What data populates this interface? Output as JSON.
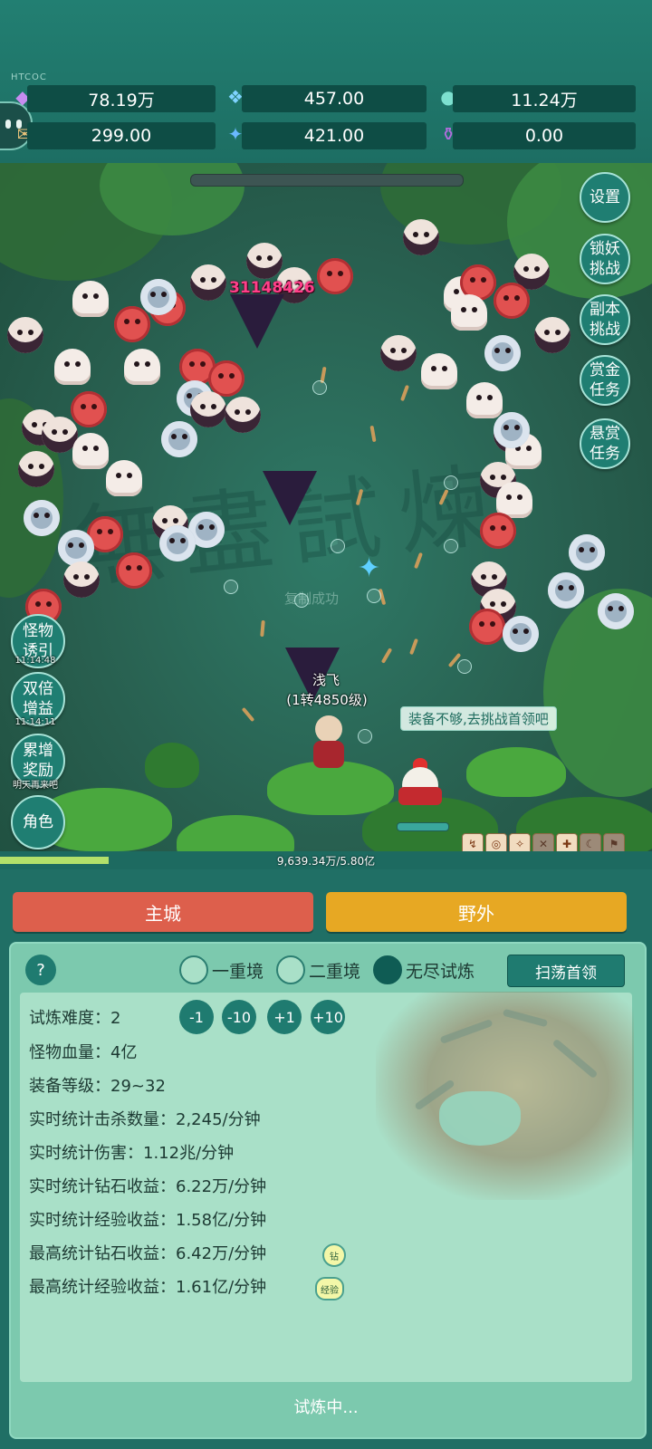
{
  "resources": {
    "diamond": "78.19万",
    "crystal": "457.00",
    "orb": "11.24万",
    "scroll": "299.00",
    "shard": "421.00",
    "potion": "0.00"
  },
  "top_tag": "HTCOC",
  "side_right": [
    {
      "label": "设置"
    },
    {
      "label": "锁妖挑战"
    },
    {
      "label": "副本挑战"
    },
    {
      "label": "赏金任务"
    },
    {
      "label": "悬赏任务"
    }
  ],
  "side_left": [
    {
      "label": "怪物诱引",
      "timer": "11:14:48"
    },
    {
      "label": "双倍增益",
      "timer": "11:14:11"
    },
    {
      "label": "累增奖励",
      "timer": "明天再来吧"
    },
    {
      "label": "角色",
      "timer": ""
    }
  ],
  "battle": {
    "damage": "31148426",
    "copy_tip": "复制成功",
    "player_name": "浅飞",
    "player_level": "(1转4850级)",
    "hint": "装备不够,去挑战首领吧"
  },
  "exp": {
    "text": "9,639.34万/5.80亿",
    "progress": 0.166
  },
  "tabs": {
    "main_city": "主城",
    "wild": "野外"
  },
  "panel": {
    "help": "?",
    "modes": [
      "一重境",
      "二重境",
      "无尽试炼"
    ],
    "selected_mode": "无尽试炼",
    "sweep": "扫荡首领",
    "difficulty_label": "试炼难度：",
    "difficulty_value": "2",
    "adjust": [
      "-1",
      "-10",
      "+1",
      "+10"
    ],
    "stats": [
      "怪物血量：4亿",
      "装备等级：29~32",
      "实时统计击杀数量：2,245/分钟",
      "实时统计伤害：1.12兆/分钟",
      "实时统计钻石收益：6.22万/分钟",
      "实时统计经验收益：1.58亿/分钟",
      "最高统计钻石收益：6.42万/分钟",
      "最高统计经验收益：1.61亿/分钟"
    ],
    "badge_diamond": "钻",
    "badge_exp": "经验",
    "status": "试炼中..."
  },
  "colors": {
    "main_city_btn": "#dd5f4c",
    "wild_btn": "#e7a823",
    "damage_text": "#ff3f89"
  }
}
